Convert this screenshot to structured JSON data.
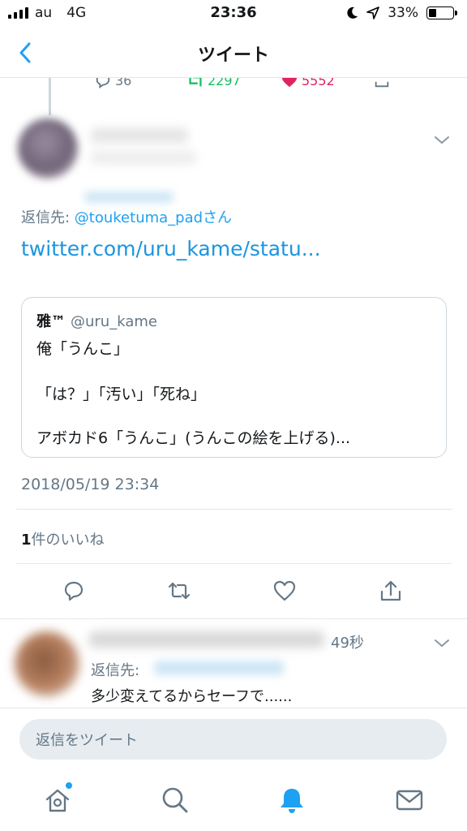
{
  "status_bar": {
    "carrier": "au",
    "network": "4G",
    "time": "23:36",
    "battery": "33%",
    "battery_level": 0.33
  },
  "nav": {
    "title": "ツイート"
  },
  "prev_tweet_actions": {
    "replies": "36",
    "retweets": "2297",
    "likes": "5552"
  },
  "tweet": {
    "reply_prefix": "返信先: ",
    "reply_mention": "@touketuma_pad",
    "reply_suffix": "さん",
    "link_text": "twitter.com/uru_kame/statu...",
    "quote": {
      "name": "雅™",
      "handle": "@uru_kame",
      "lines": [
        "俺「うんこ」",
        "「は？」「汚い」「死ね」",
        "アボカド6「うんこ」(うんこの絵を上げる)..."
      ]
    },
    "timestamp": "2018/05/19 23:34",
    "likes_count": "1",
    "likes_label": "件のいいね"
  },
  "reply": {
    "time": "49秒",
    "reply_prefix": "返信先: ",
    "text": "多少変えてるからセーフで......"
  },
  "compose": {
    "placeholder": "返信をツイート"
  },
  "colors": {
    "accent": "#1da1f2",
    "link": "#1b95e0",
    "retweet_green": "#17bf63",
    "like_red": "#e0245e",
    "secondary_text": "#657786"
  }
}
